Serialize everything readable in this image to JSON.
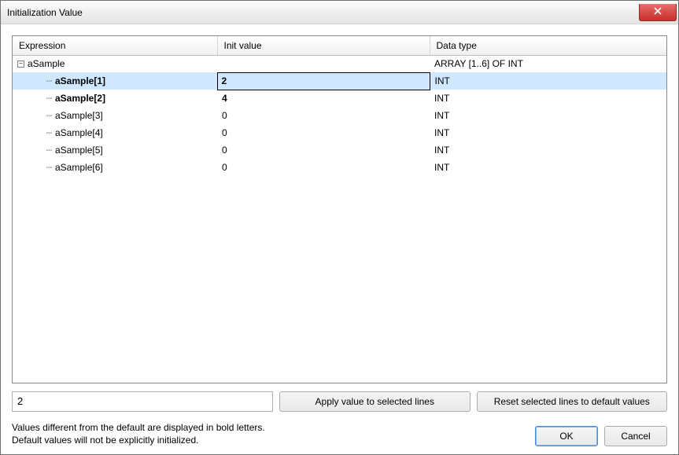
{
  "titlebar": {
    "title": "Initialization Value"
  },
  "table": {
    "headers": {
      "expression": "Expression",
      "init_value": "Init value",
      "data_type": "Data type"
    },
    "root": {
      "expression": "aSample",
      "init_value": "",
      "data_type": "ARRAY [1..6] OF INT"
    },
    "rows": [
      {
        "expression": "aSample[1]",
        "init_value": "2",
        "data_type": "INT",
        "bold": true,
        "selected": true
      },
      {
        "expression": "aSample[2]",
        "init_value": "4",
        "data_type": "INT",
        "bold": true,
        "selected": false
      },
      {
        "expression": "aSample[3]",
        "init_value": "0",
        "data_type": "INT",
        "bold": false,
        "selected": false
      },
      {
        "expression": "aSample[4]",
        "init_value": "0",
        "data_type": "INT",
        "bold": false,
        "selected": false
      },
      {
        "expression": "aSample[5]",
        "init_value": "0",
        "data_type": "INT",
        "bold": false,
        "selected": false
      },
      {
        "expression": "aSample[6]",
        "init_value": "0",
        "data_type": "INT",
        "bold": false,
        "selected": false
      }
    ]
  },
  "input": {
    "value": "2"
  },
  "buttons": {
    "apply": "Apply value to selected lines",
    "reset": "Reset selected lines to default values",
    "ok": "OK",
    "cancel": "Cancel"
  },
  "hint": {
    "line1": "Values different from the default are displayed in bold letters.",
    "line2": "Default values will not be explicitly initialized."
  }
}
